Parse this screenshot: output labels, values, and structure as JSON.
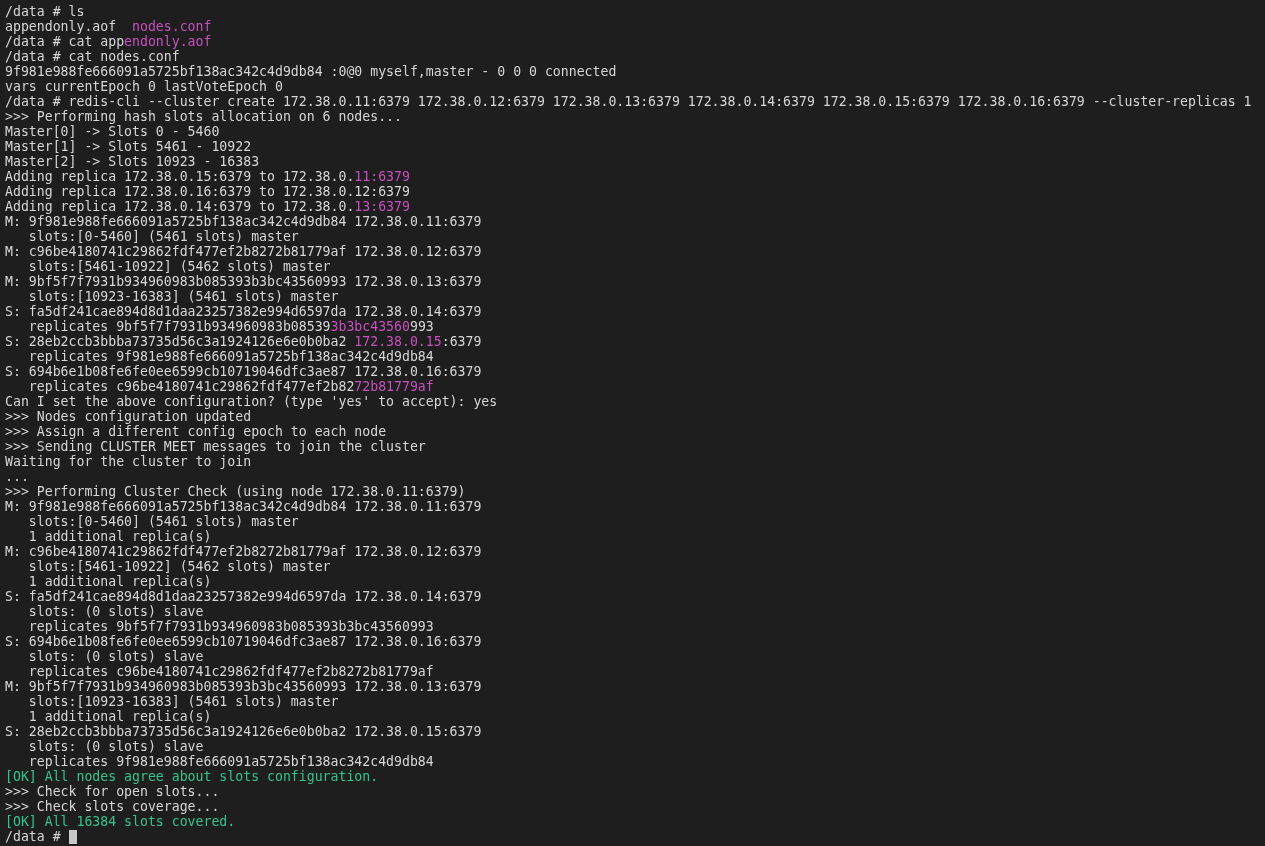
{
  "terminal": {
    "lines": [
      {
        "text": "/data # ls"
      },
      {
        "segments": [
          {
            "text": "appendonly.aof  ",
            "kind": "plain"
          },
          {
            "text": "nodes.conf",
            "kind": "highlight"
          }
        ]
      },
      {
        "segments": [
          {
            "text": "/data # cat app",
            "kind": "plain"
          },
          {
            "text": "endonly.aof",
            "kind": "highlight"
          }
        ]
      },
      {
        "text": "/data # cat nodes.conf"
      },
      {
        "text": "9f981e988fe666091a5725bf138ac342c4d9db84 :0@0 myself,master - 0 0 0 connected"
      },
      {
        "text": "vars currentEpoch 0 lastVoteEpoch 0"
      },
      {
        "text": "/data # redis-cli --cluster create 172.38.0.11:6379 172.38.0.12:6379 172.38.0.13:6379 172.38.0.14:6379 172.38.0.15:6379 172.38.0.16:6379 --cluster-replicas 1"
      },
      {
        "text": ">>> Performing hash slots allocation on 6 nodes..."
      },
      {
        "text": "Master[0] -> Slots 0 - 5460"
      },
      {
        "text": "Master[1] -> Slots 5461 - 10922"
      },
      {
        "text": "Master[2] -> Slots 10923 - 16383"
      },
      {
        "segments": [
          {
            "text": "Adding replica 172.38.0.15:6379 to 172.38.0.",
            "kind": "plain"
          },
          {
            "text": "11:6379",
            "kind": "highlight"
          }
        ]
      },
      {
        "text": "Adding replica 172.38.0.16:6379 to 172.38.0.12:6379"
      },
      {
        "segments": [
          {
            "text": "Adding replica 172.38.0.14:6379 to 172.38.0.",
            "kind": "plain"
          },
          {
            "text": "13:6379",
            "kind": "highlight"
          }
        ]
      },
      {
        "text": "M: 9f981e988fe666091a5725bf138ac342c4d9db84 172.38.0.11:6379"
      },
      {
        "text": "   slots:[0-5460] (5461 slots) master"
      },
      {
        "text": "M: c96be4180741c29862fdf477ef2b8272b81779af 172.38.0.12:6379"
      },
      {
        "text": "   slots:[5461-10922] (5462 slots) master"
      },
      {
        "text": "M: 9bf5f7f7931b934960983b085393b3bc43560993 172.38.0.13:6379"
      },
      {
        "text": "   slots:[10923-16383] (5461 slots) master"
      },
      {
        "text": "S: fa5df241cae894d8d1daa23257382e994d6597da 172.38.0.14:6379"
      },
      {
        "segments": [
          {
            "text": "   replicates 9bf5f7f7931b934960983b08539",
            "kind": "plain"
          },
          {
            "text": "3b3bc43560",
            "kind": "highlight"
          },
          {
            "text": "993",
            "kind": "plain"
          }
        ]
      },
      {
        "segments": [
          {
            "text": "S: 28eb2ccb3bbba73735d56c3a1924126e6e0b0ba2 ",
            "kind": "plain"
          },
          {
            "text": "172.38.0.15",
            "kind": "highlight"
          },
          {
            "text": ":6379",
            "kind": "plain"
          }
        ]
      },
      {
        "text": "   replicates 9f981e988fe666091a5725bf138ac342c4d9db84"
      },
      {
        "text": "S: 694b6e1b08fe6fe0ee6599cb10719046dfc3ae87 172.38.0.16:6379"
      },
      {
        "segments": [
          {
            "text": "   replicates c96be4180741c29862fdf477ef2b82",
            "kind": "plain"
          },
          {
            "text": "72b81779af",
            "kind": "highlight"
          }
        ]
      },
      {
        "text": "Can I set the above configuration? (type 'yes' to accept): yes"
      },
      {
        "text": ">>> Nodes configuration updated"
      },
      {
        "text": ">>> Assign a different config epoch to each node"
      },
      {
        "text": ">>> Sending CLUSTER MEET messages to join the cluster"
      },
      {
        "text": "Waiting for the cluster to join"
      },
      {
        "text": "..."
      },
      {
        "text": ">>> Performing Cluster Check (using node 172.38.0.11:6379)"
      },
      {
        "text": "M: 9f981e988fe666091a5725bf138ac342c4d9db84 172.38.0.11:6379"
      },
      {
        "text": "   slots:[0-5460] (5461 slots) master"
      },
      {
        "text": "   1 additional replica(s)"
      },
      {
        "text": "M: c96be4180741c29862fdf477ef2b8272b81779af 172.38.0.12:6379"
      },
      {
        "text": "   slots:[5461-10922] (5462 slots) master"
      },
      {
        "text": "   1 additional replica(s)"
      },
      {
        "text": "S: fa5df241cae894d8d1daa23257382e994d6597da 172.38.0.14:6379"
      },
      {
        "text": "   slots: (0 slots) slave"
      },
      {
        "text": "   replicates 9bf5f7f7931b934960983b085393b3bc43560993"
      },
      {
        "text": "S: 694b6e1b08fe6fe0ee6599cb10719046dfc3ae87 172.38.0.16:6379"
      },
      {
        "text": "   slots: (0 slots) slave"
      },
      {
        "text": "   replicates c96be4180741c29862fdf477ef2b8272b81779af"
      },
      {
        "text": "M: 9bf5f7f7931b934960983b085393b3bc43560993 172.38.0.13:6379"
      },
      {
        "text": "   slots:[10923-16383] (5461 slots) master"
      },
      {
        "text": "   1 additional replica(s)"
      },
      {
        "text": "S: 28eb2ccb3bbba73735d56c3a1924126e6e0b0ba2 172.38.0.15:6379"
      },
      {
        "text": "   slots: (0 slots) slave"
      },
      {
        "text": "   replicates 9f981e988fe666091a5725bf138ac342c4d9db84"
      },
      {
        "text": "[OK] All nodes agree about slots configuration.",
        "kind": "ok"
      },
      {
        "text": ">>> Check for open slots..."
      },
      {
        "text": ">>> Check slots coverage..."
      },
      {
        "text": "[OK] All 16384 slots covered.",
        "kind": "ok"
      },
      {
        "text": "/data #",
        "cursor": true
      }
    ]
  }
}
